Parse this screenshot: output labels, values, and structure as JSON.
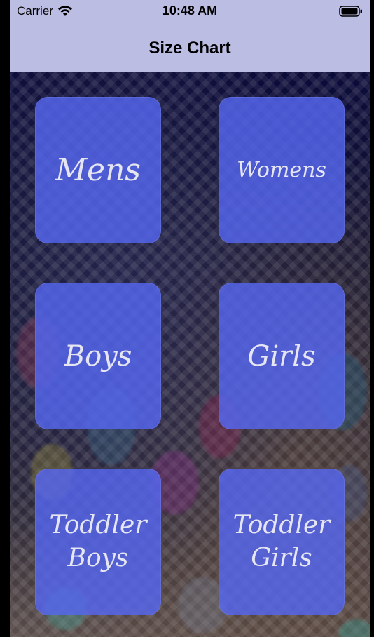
{
  "status_bar": {
    "carrier": "Carrier",
    "time": "10:48 AM",
    "wifi_icon": "wifi-icon",
    "battery_icon": "battery-icon"
  },
  "nav": {
    "title": "Size Chart"
  },
  "tiles": [
    {
      "label": "Mens"
    },
    {
      "label": "Womens"
    },
    {
      "label": "Boys"
    },
    {
      "label": "Girls"
    },
    {
      "label": "Toddler Boys"
    },
    {
      "label": "Toddler Girls"
    }
  ],
  "colors": {
    "nav_background": "#bcbde3",
    "tile_background": "#5666f0",
    "tile_text": "#e6e6f2"
  }
}
